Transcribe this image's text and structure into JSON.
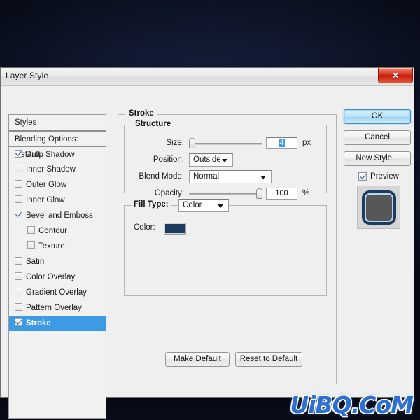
{
  "window": {
    "title": "Layer Style",
    "close_label": "✕"
  },
  "styles_panel": {
    "header": "Styles",
    "blending_options": "Blending Options: Default",
    "items": [
      {
        "label": "Drop Shadow",
        "checked": true,
        "indent": false,
        "selected": false
      },
      {
        "label": "Inner Shadow",
        "checked": false,
        "indent": false,
        "selected": false
      },
      {
        "label": "Outer Glow",
        "checked": false,
        "indent": false,
        "selected": false
      },
      {
        "label": "Inner Glow",
        "checked": false,
        "indent": false,
        "selected": false
      },
      {
        "label": "Bevel and Emboss",
        "checked": true,
        "indent": false,
        "selected": false
      },
      {
        "label": "Contour",
        "checked": false,
        "indent": true,
        "selected": false
      },
      {
        "label": "Texture",
        "checked": false,
        "indent": true,
        "selected": false
      },
      {
        "label": "Satin",
        "checked": false,
        "indent": false,
        "selected": false
      },
      {
        "label": "Color Overlay",
        "checked": false,
        "indent": false,
        "selected": false
      },
      {
        "label": "Gradient Overlay",
        "checked": false,
        "indent": false,
        "selected": false
      },
      {
        "label": "Pattern Overlay",
        "checked": false,
        "indent": false,
        "selected": false
      },
      {
        "label": "Stroke",
        "checked": true,
        "indent": false,
        "selected": true
      }
    ]
  },
  "main": {
    "group_title": "Stroke",
    "structure": {
      "legend": "Structure",
      "size_label": "Size:",
      "size_value": "4",
      "size_unit": "px",
      "size_slider_percent": 2,
      "position_label": "Position:",
      "position_value": "Outside",
      "blend_mode_label": "Blend Mode:",
      "blend_mode_value": "Normal",
      "opacity_label": "Opacity:",
      "opacity_value": "100",
      "opacity_unit": "%",
      "opacity_slider_percent": 100
    },
    "fill": {
      "fill_type_label": "Fill Type:",
      "fill_type_value": "Color",
      "color_label": "Color:",
      "color_value": "#1d3b5c"
    },
    "make_default": "Make Default",
    "reset_default": "Reset to Default"
  },
  "right_panel": {
    "ok": "OK",
    "cancel": "Cancel",
    "new_style": "New Style...",
    "preview": "Preview",
    "preview_checked": true
  },
  "watermark": "UiBQ.CoM",
  "colors": {
    "accent_selection": "#3d9ae5",
    "stroke_color": "#1d3b5c",
    "close_red": "#c31d0c",
    "desktop_bg": "#131c36"
  }
}
